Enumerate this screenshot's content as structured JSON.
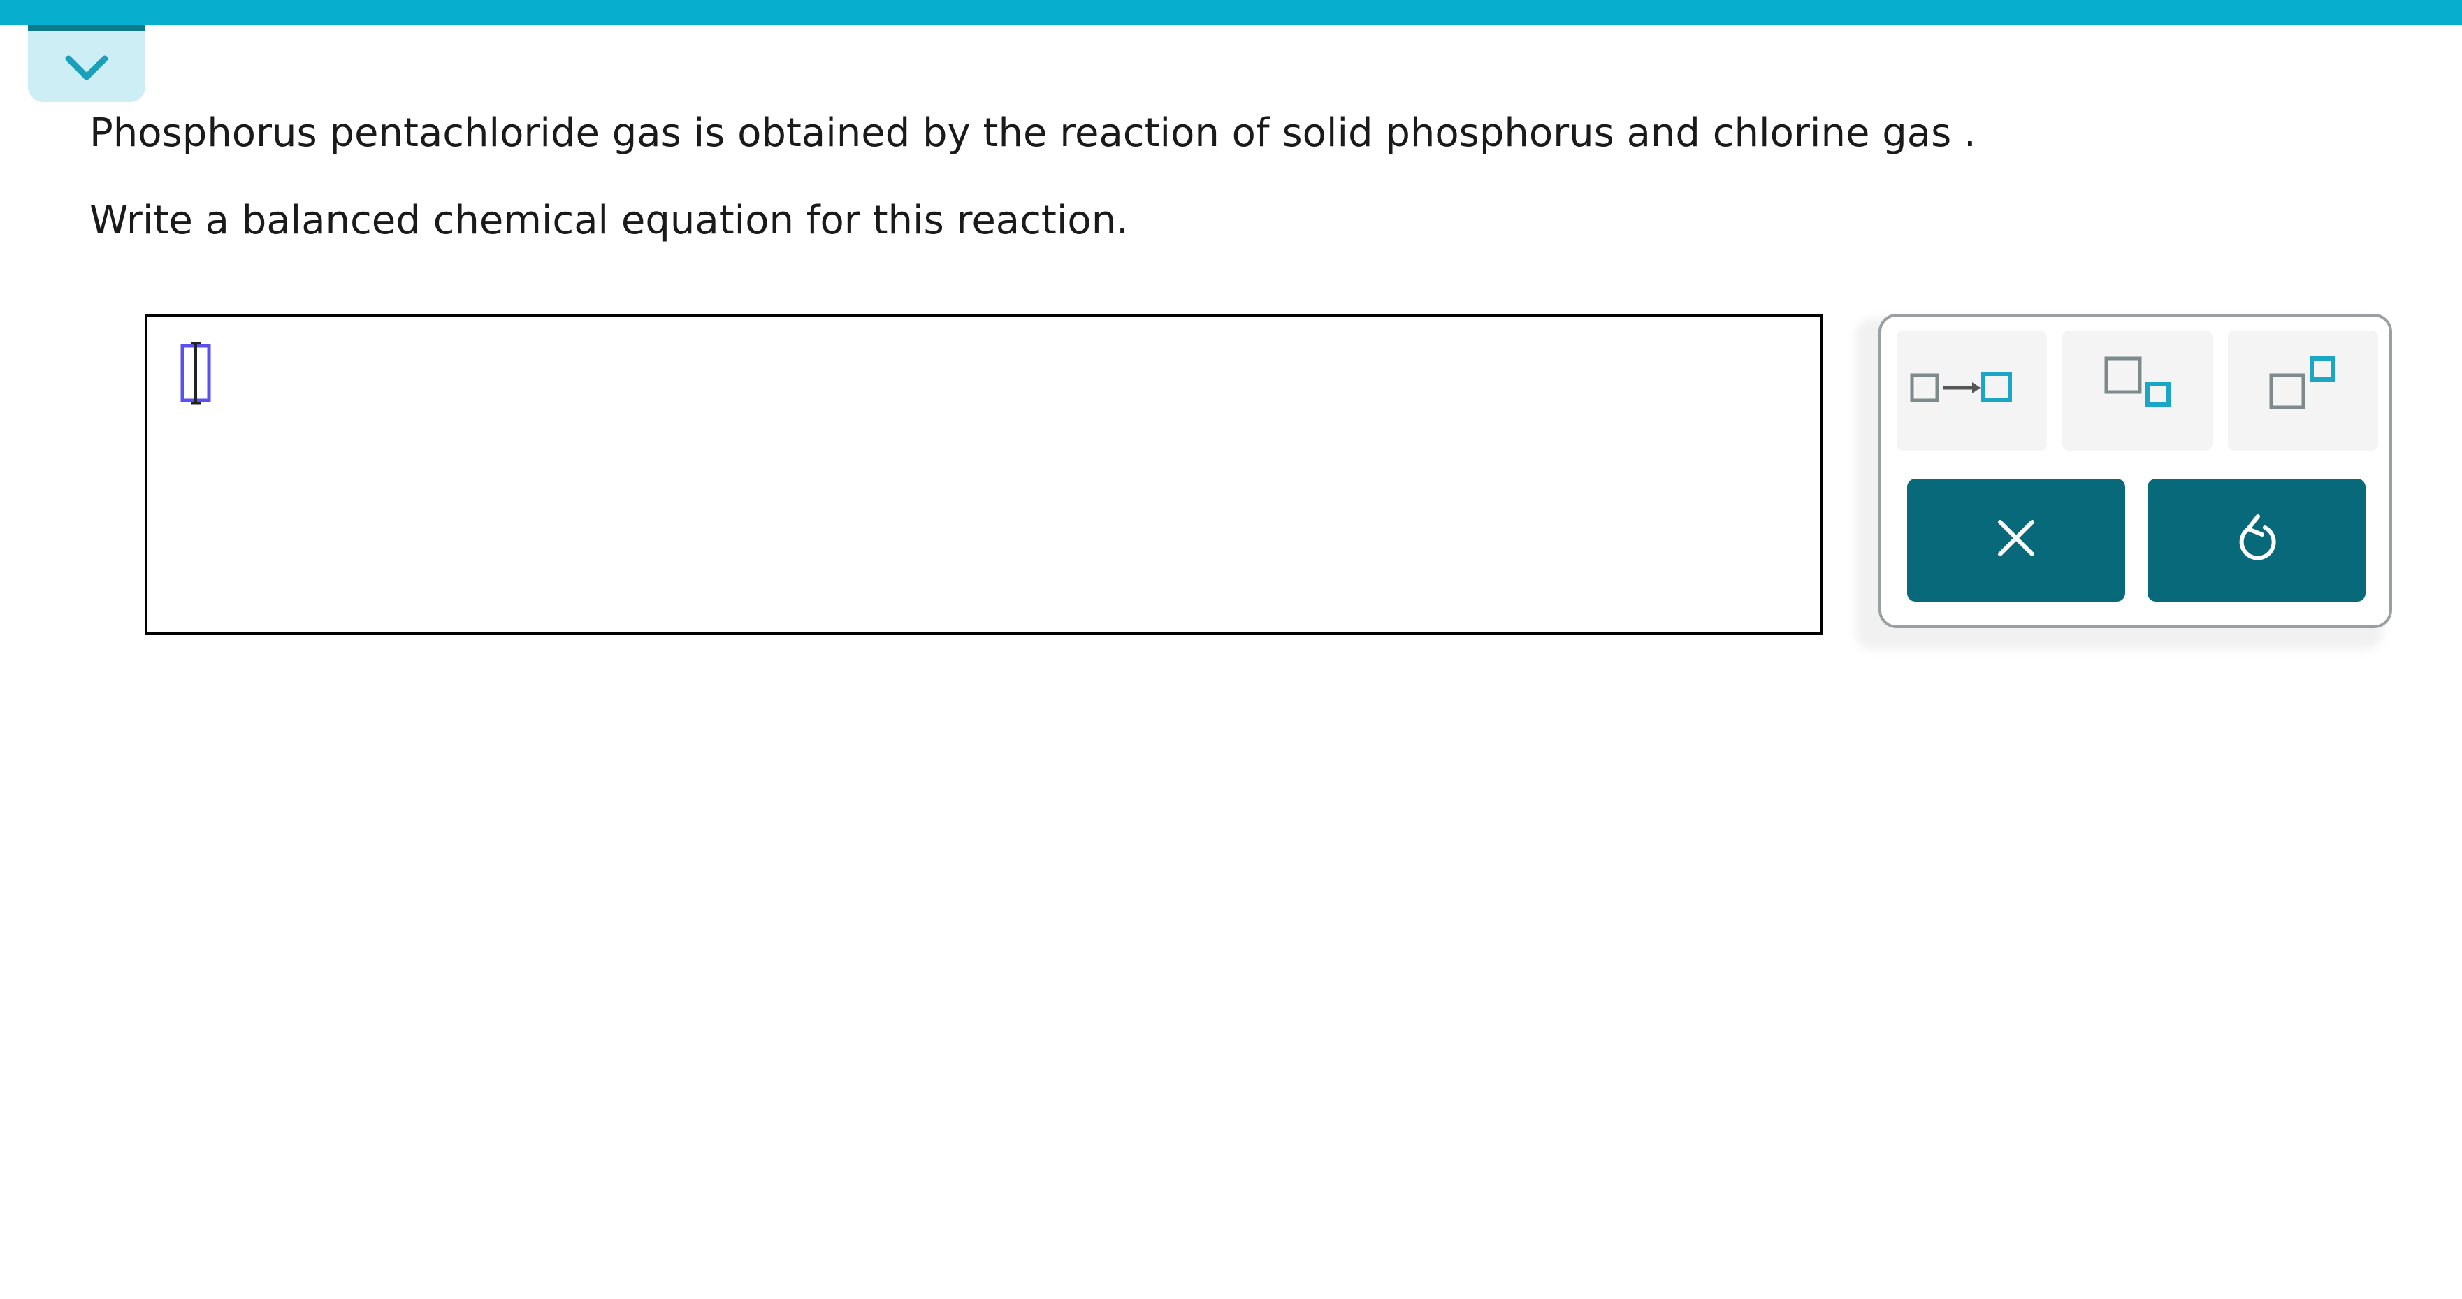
{
  "question": {
    "line1": "Phosphorus pentachloride gas is obtained by the reaction of solid phosphorus and chlorine gas .",
    "line2": "Write a balanced chemical equation for this reaction."
  },
  "answer": {
    "value": ""
  },
  "toolbar": {
    "buttons": [
      {
        "name": "reaction-arrow",
        "icon": "box-arrow-box-icon"
      },
      {
        "name": "subscript",
        "icon": "subscript-icon"
      },
      {
        "name": "superscript",
        "icon": "superscript-icon"
      }
    ],
    "actions": [
      {
        "name": "clear",
        "icon": "close-icon"
      },
      {
        "name": "undo",
        "icon": "undo-icon"
      }
    ]
  },
  "colors": {
    "top_bar": "#08aece",
    "accent": "#08697a",
    "icon_teal": "#1aa6c4",
    "caret": "#5b4ff0"
  }
}
